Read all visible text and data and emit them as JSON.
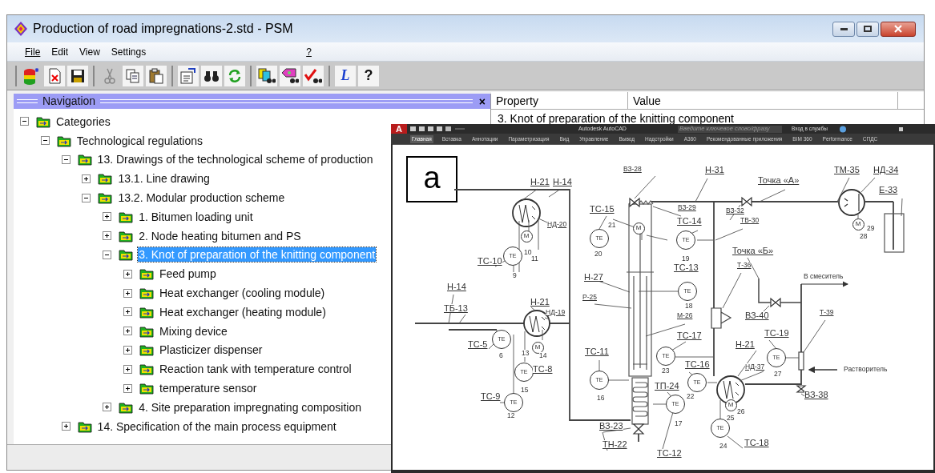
{
  "window": {
    "title": "Production of road impregnations-2.std - PSM"
  },
  "menu": [
    {
      "label": "File",
      "underlined": true
    },
    {
      "label": "Edit",
      "underlined": false
    },
    {
      "label": "View",
      "underlined": false
    },
    {
      "label": "Settings",
      "underlined": false
    },
    {
      "label": "?",
      "underlined": true
    }
  ],
  "toolbar": {
    "glyphs": [
      "L",
      "?"
    ]
  },
  "navigation": {
    "title": "Navigation",
    "close": "×",
    "tree": [
      {
        "label": "Categories",
        "expanded": true,
        "selected": false,
        "children": [
          {
            "label": "Technological regulations",
            "expanded": true,
            "selected": false,
            "children": [
              {
                "label": "13. Drawings of the technological scheme of production",
                "expanded": true,
                "selected": false,
                "children": [
                  {
                    "label": "13.1. Line drawing",
                    "expanded": false,
                    "selected": false
                  },
                  {
                    "label": "13.2. Modular production scheme",
                    "expanded": true,
                    "selected": false,
                    "children": [
                      {
                        "label": "1. Bitumen loading unit",
                        "expanded": false,
                        "selected": false
                      },
                      {
                        "label": "2. Node heating bitumen and PS",
                        "expanded": false,
                        "selected": false
                      },
                      {
                        "label": "3. Knot of preparation of the knitting component",
                        "expanded": true,
                        "selected": true,
                        "children": [
                          {
                            "label": "Feed pump",
                            "expanded": false,
                            "selected": false
                          },
                          {
                            "label": "Heat exchanger (cooling module)",
                            "expanded": false,
                            "selected": false
                          },
                          {
                            "label": "Heat exchanger (heating module)",
                            "expanded": false,
                            "selected": false
                          },
                          {
                            "label": "Mixing device",
                            "expanded": false,
                            "selected": false
                          },
                          {
                            "label": "Plasticizer dispenser",
                            "expanded": false,
                            "selected": false
                          },
                          {
                            "label": "Reaction tank with temperature control",
                            "expanded": false,
                            "selected": false
                          },
                          {
                            "label": "temperature sensor",
                            "expanded": false,
                            "selected": false
                          }
                        ]
                      },
                      {
                        "label": "4. Site preparation impregnating composition",
                        "expanded": false,
                        "selected": false
                      }
                    ]
                  }
                ]
              },
              {
                "label": "14. Specification of the main process equipment",
                "expanded": false,
                "selected": false
              }
            ]
          }
        ]
      }
    ]
  },
  "properties": {
    "columns": [
      "Property",
      "Value"
    ],
    "rows": [
      "3. Knot of preparation of the knitting component"
    ]
  },
  "autocad": {
    "logo": "A",
    "title": "Autodesk AutoCAD",
    "search_placeholder": "Введите ключевое слово/фразу",
    "sign_in": "Вход в службы",
    "ribbon_tabs": [
      {
        "label": "Главная",
        "selected": true
      },
      {
        "label": "Вставка",
        "selected": false
      },
      {
        "label": "Аннотации",
        "selected": false
      },
      {
        "label": "Параметризация",
        "selected": false
      },
      {
        "label": "Вид",
        "selected": false
      },
      {
        "label": "Управление",
        "selected": false
      },
      {
        "label": "Вывод",
        "selected": false
      },
      {
        "label": "Надстройки",
        "selected": false
      },
      {
        "label": "A360",
        "selected": false
      },
      {
        "label": "Рекомендованные приложения",
        "selected": false
      },
      {
        "label": "BIM 360",
        "selected": false
      },
      {
        "label": "Performance",
        "selected": false
      },
      {
        "label": "СПДС",
        "selected": false
      }
    ]
  },
  "drawing": {
    "panel_label": "a",
    "instruments": [
      {
        "text": "TE"
      },
      {
        "text": "TE"
      },
      {
        "text": "TE"
      },
      {
        "text": "TE"
      },
      {
        "text": "TE"
      },
      {
        "text": "TE"
      },
      {
        "text": "TE"
      },
      {
        "text": "TE"
      },
      {
        "text": "TE"
      },
      {
        "text": "TE"
      },
      {
        "text": "TE"
      },
      {
        "text": "TE"
      },
      {
        "text": "TE"
      }
    ],
    "motors": [
      {
        "text": "M"
      },
      {
        "text": "M"
      },
      {
        "text": "M"
      },
      {
        "text": "M"
      },
      {
        "text": "M"
      }
    ],
    "labels": [
      {
        "text": "Н-21",
        "underlined": true
      },
      {
        "text": "Н-14",
        "underlined": true
      },
      {
        "text": "НД-20",
        "underlined": true
      },
      {
        "text": "ТС-10",
        "underlined": true
      },
      {
        "text": "10",
        "underlined": false
      },
      {
        "text": "11",
        "underlined": false
      },
      {
        "text": "9",
        "underlined": false
      },
      {
        "text": "ТС-15",
        "underlined": true
      },
      {
        "text": "21",
        "underlined": false
      },
      {
        "text": "20",
        "underlined": false
      },
      {
        "text": "ВЗ-28",
        "underlined": true
      },
      {
        "text": "Н-31",
        "underlined": true
      },
      {
        "text": "ВЗ-29",
        "underlined": true
      },
      {
        "text": "ТС-14",
        "underlined": true
      },
      {
        "text": "19",
        "underlined": false
      },
      {
        "text": "ВЗ-32",
        "underlined": true
      },
      {
        "text": "ТВ-30",
        "underlined": true
      },
      {
        "text": "Точка «А»",
        "underlined": true
      },
      {
        "text": "ТМ-35",
        "underlined": true
      },
      {
        "text": "НД-34",
        "underlined": true
      },
      {
        "text": "Е-33",
        "underlined": true
      },
      {
        "text": "29",
        "underlined": false
      },
      {
        "text": "28",
        "underlined": false
      },
      {
        "text": "Точка «Б»",
        "underlined": true
      },
      {
        "text": "Т-36",
        "underlined": true
      },
      {
        "text": "В смеситель",
        "underlined": false
      },
      {
        "text": "ТС-13",
        "underlined": true
      },
      {
        "text": "18",
        "underlined": false
      },
      {
        "text": "Н-27",
        "underlined": true
      },
      {
        "text": "Р-25",
        "underlined": true
      },
      {
        "text": "М-26",
        "underlined": true
      },
      {
        "text": "Н-14",
        "underlined": true
      },
      {
        "text": "ТБ-13",
        "underlined": true
      },
      {
        "text": "Н-21",
        "underlined": true
      },
      {
        "text": "НД-19",
        "underlined": true
      },
      {
        "text": "ТС-5",
        "underlined": true
      },
      {
        "text": "6",
        "underlined": false
      },
      {
        "text": "13",
        "underlined": false
      },
      {
        "text": "14",
        "underlined": false
      },
      {
        "text": "ТС-8",
        "underlined": true
      },
      {
        "text": "15",
        "underlined": false
      },
      {
        "text": "ТС-9",
        "underlined": true
      },
      {
        "text": "12",
        "underlined": false
      },
      {
        "text": "ТС-11",
        "underlined": true
      },
      {
        "text": "16",
        "underlined": false
      },
      {
        "text": "ТС-17",
        "underlined": true
      },
      {
        "text": "23",
        "underlined": false
      },
      {
        "text": "ТС-16",
        "underlined": true
      },
      {
        "text": "22",
        "underlined": false
      },
      {
        "text": "ТП-24",
        "underlined": true
      },
      {
        "text": "17",
        "underlined": false
      },
      {
        "text": "ТС-12",
        "underlined": true
      },
      {
        "text": "ВЗ-23",
        "underlined": true
      },
      {
        "text": "ТН-22",
        "underlined": true
      },
      {
        "text": "Н-21",
        "underlined": true
      },
      {
        "text": "НД-37",
        "underlined": true
      },
      {
        "text": "ТС-19",
        "underlined": true
      },
      {
        "text": "27",
        "underlined": false
      },
      {
        "text": "Т-39",
        "underlined": true
      },
      {
        "text": "Растворитель",
        "underlined": false
      },
      {
        "text": "ВЗ-38",
        "underlined": true
      },
      {
        "text": "ВЗ-40",
        "underlined": true
      },
      {
        "text": "25",
        "underlined": false
      },
      {
        "text": "26",
        "underlined": false
      },
      {
        "text": "24",
        "underlined": false
      },
      {
        "text": "ТС-18",
        "underlined": true
      }
    ]
  }
}
